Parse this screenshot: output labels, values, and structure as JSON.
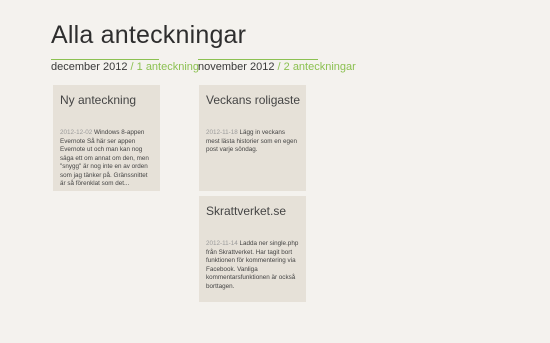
{
  "page": {
    "title": "Alla anteckningar"
  },
  "groups": [
    {
      "month": "december 2012",
      "separator": "/",
      "count": "1 anteckning"
    },
    {
      "month": "november 2012",
      "separator": "/",
      "count": "2 anteckningar"
    }
  ],
  "notes": [
    {
      "title": "Ny anteckning",
      "date": "2012-12-02",
      "text": "Windows 8-appen Evernote Så här ser appen Evernote ut och man kan nog säga ett om annat om den, men \"snygg\" är nog inte en av orden som jag tänker på. Gränssnittet är så förenklat som det..."
    },
    {
      "title": "Veckans roligaste",
      "date": "2012-11-18",
      "text": "Lägg in veckans mest lästa historier som en egen post varje söndag."
    },
    {
      "title": "Skrattverket.se",
      "date": "2012-11-14",
      "text": "Ladda ner single.php från Skrattverket. Har tagit bort funktionen för kommentering via Facebook. Vanliga kommentarsfunktionen är också borttagen."
    }
  ],
  "colors": {
    "accent": "#8cc152",
    "tile": "#e6e1d8",
    "background": "#f4f2ee"
  }
}
